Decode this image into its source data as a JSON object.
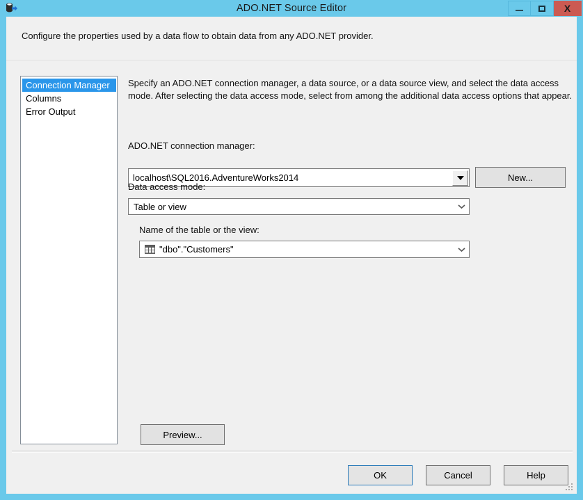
{
  "window": {
    "title": "ADO.NET Source Editor",
    "icon": "data-source-icon",
    "controls": {
      "minimize": "minimize-icon",
      "maximize": "maximize-icon",
      "close": "X"
    }
  },
  "header": {
    "description": "Configure the properties used by a data flow to obtain data from any ADO.NET provider."
  },
  "sidebar": {
    "items": [
      {
        "label": "Connection Manager",
        "selected": true
      },
      {
        "label": "Columns",
        "selected": false
      },
      {
        "label": "Error Output",
        "selected": false
      }
    ]
  },
  "main": {
    "description": "Specify an ADO.NET connection manager, a data source, or a data source view, and select the data access mode. After selecting the data access mode, select from among the additional data access options that appear.",
    "connection_manager": {
      "label": "ADO.NET connection manager:",
      "value": "localhost\\SQL2016.AdventureWorks2014",
      "new_button": "New..."
    },
    "data_access_mode": {
      "label": "Data access mode:",
      "value": "Table or view"
    },
    "table_or_view": {
      "label": "Name of the table or the view:",
      "value": "\"dbo\".\"Customers\"",
      "icon": "table-icon"
    },
    "preview_button": "Preview..."
  },
  "footer": {
    "ok": "OK",
    "cancel": "Cancel",
    "help": "Help"
  },
  "colors": {
    "titlebar": "#6ac9ea",
    "close_button": "#cb5a52",
    "selection": "#2a96ea",
    "dialog_bg": "#f0f0f0",
    "default_button_border": "#2a7ab9"
  }
}
